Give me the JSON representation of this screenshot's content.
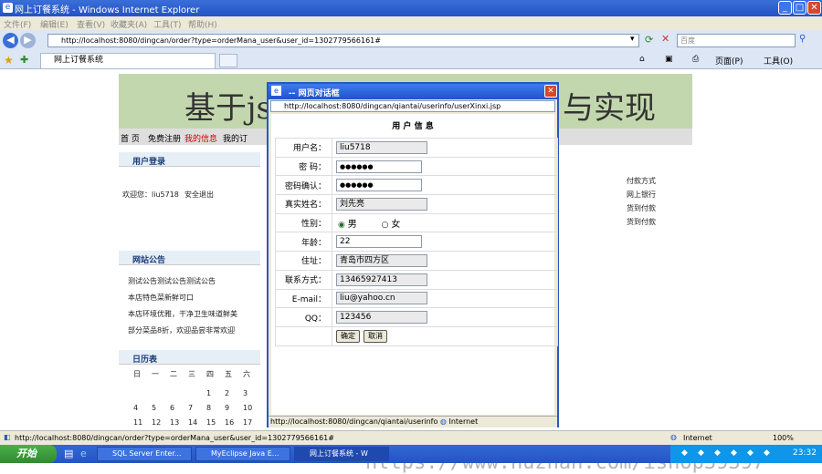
{
  "window": {
    "title": "网上订餐系统 - Windows Internet Explorer"
  },
  "menu": [
    "文件(F)",
    "编辑(E)",
    "查看(V)",
    "收藏夹(A)",
    "工具(T)",
    "帮助(H)"
  ],
  "address": {
    "url": "http://localhost:8080/dingcan/order?type=orderMana_user&user_id=1302779566161#"
  },
  "search": {
    "placeholder": "百度"
  },
  "tab": {
    "label": "网上订餐系统"
  },
  "toolbar": {
    "page_label": "页面(P)",
    "tools_label": "工具(O)"
  },
  "site": {
    "banner_left": "基于jsp",
    "banner_right": "与实现",
    "nav": [
      "首 页",
      "免费注册",
      "我的信息",
      "我的订"
    ],
    "login_box_title": "用户登录",
    "welcome_text": "欢迎您：liu5718",
    "logout_text": "安全退出",
    "notice_box_title": "网站公告",
    "notices": [
      "测试公告测试公告测试公告",
      "本店特色菜新鲜可口",
      "本店环境优雅，干净卫生味道鲜美",
      "部分菜品8折，欢迎品尝非常欢迎"
    ],
    "calendar_box_title": "日历表",
    "weekdays": [
      "日",
      "一",
      "二",
      "三",
      "四",
      "五",
      "六"
    ],
    "cal_row1": [
      "1",
      "2",
      "3"
    ],
    "cal_row2": [
      "4",
      "5",
      "6",
      "7",
      "8",
      "9",
      "10"
    ],
    "cal_row3": [
      "11",
      "12",
      "13",
      "14",
      "15",
      "16",
      "17"
    ],
    "right_links": [
      "付款方式",
      "网上银行",
      "货到付款",
      "货到付款"
    ]
  },
  "dialog": {
    "title": "-- 网页对话框",
    "url": "http://localhost:8080/dingcan/qiantai/userinfo/userXinxi.jsp",
    "heading": "用 户 信 息",
    "labels": {
      "username": "用户名：",
      "password": "密  码：",
      "confirm": "密码确认：",
      "realname": "真实姓名：",
      "gender": "性别：",
      "age": "年龄：",
      "address": "住址：",
      "phone": "联系方式：",
      "email": "E-mail：",
      "qq": "QQ："
    },
    "values": {
      "username": "liu5718",
      "password": "●●●●●●",
      "confirm": "●●●●●●",
      "realname": "刘先亮",
      "gender_male": "男",
      "gender_female": "女",
      "age": "22",
      "address": "青岛市四方区",
      "phone": "13465927413",
      "email": "liu@yahoo.cn",
      "qq": "123456"
    },
    "ok_label": "确定",
    "cancel_label": "取消",
    "status": "http://localhost:8080/dingcan/qiantai/userinfo",
    "status_zone": "Internet"
  },
  "statusbar": {
    "url": "http://localhost:8080/dingcan/order?type=orderMana_user&user_id=1302779566161#",
    "zone": "Internet",
    "zoom": "100%"
  },
  "taskbar": {
    "start": "开始",
    "tasks": [
      "SQL Server Enter...",
      "MyEclipse Java E...",
      "网上订餐系统 - W"
    ],
    "clock": "23:32"
  },
  "watermark": "https://www.huzhan.com/ishop39397"
}
